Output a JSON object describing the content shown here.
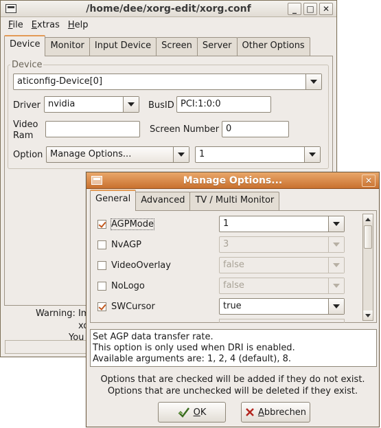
{
  "main_window": {
    "title": "/home/dee/xorg-edit/xorg.conf",
    "controls": {
      "minimize": "_",
      "maximize": "□",
      "close": "✕"
    },
    "menu": [
      {
        "accel": "F",
        "rest": "ile"
      },
      {
        "accel": "E",
        "rest": "xtras"
      },
      {
        "accel": "H",
        "rest": "elp"
      }
    ],
    "tabs": [
      "Device",
      "Monitor",
      "Input Device",
      "Screen",
      "Server",
      "Other Options"
    ],
    "active_tab": "Device",
    "device_group": {
      "label": "Device",
      "device_select": "aticonfig-Device[0]",
      "driver_label": "Driver",
      "driver_value": "nvidia",
      "busid_label": "BusID",
      "busid_value": "PCI:1:0:0",
      "videoram_label_line1": "Video",
      "videoram_label_line2": "Ram",
      "videoram_value": "",
      "screen_number_label": "Screen Number",
      "screen_number_value": "0",
      "option_label": "Option",
      "option_select": "Manage Options...",
      "option_value": "1"
    },
    "warning_fragments": {
      "line1": "Warning: Im",
      "line2": "xo",
      "line3": "You"
    }
  },
  "dialog": {
    "title": "Manage Options...",
    "controls": {
      "close": "✕"
    },
    "tabs": [
      "General",
      "Advanced",
      "TV / Multi Monitor"
    ],
    "active_tab": "General",
    "options": [
      {
        "name": "AGPMode",
        "checked": true,
        "value": "1",
        "enabled": true
      },
      {
        "name": "NvAGP",
        "checked": false,
        "value": "3",
        "enabled": false
      },
      {
        "name": "VideoOverlay",
        "checked": false,
        "value": "false",
        "enabled": false
      },
      {
        "name": "NoLogo",
        "checked": false,
        "value": "false",
        "enabled": false
      },
      {
        "name": "SWCursor",
        "checked": true,
        "value": "true",
        "enabled": true
      }
    ],
    "description": [
      "Set AGP data transfer rate.",
      "This option is only used when DRI is enabled.",
      "Available arguments are: 1, 2, 4 (default), 8."
    ],
    "info_line1": "Options that are checked will be added if they do not exist.",
    "info_line2": "Options that are unchecked will be deleted if they exist.",
    "ok_button": {
      "accel": "O",
      "rest": "K"
    },
    "cancel_button": {
      "accel": "A",
      "rest": "bbrechen"
    },
    "colors": {
      "titlebar": "#d98a45",
      "check": "#c3591e",
      "tab_accent": "#e39a55"
    }
  }
}
